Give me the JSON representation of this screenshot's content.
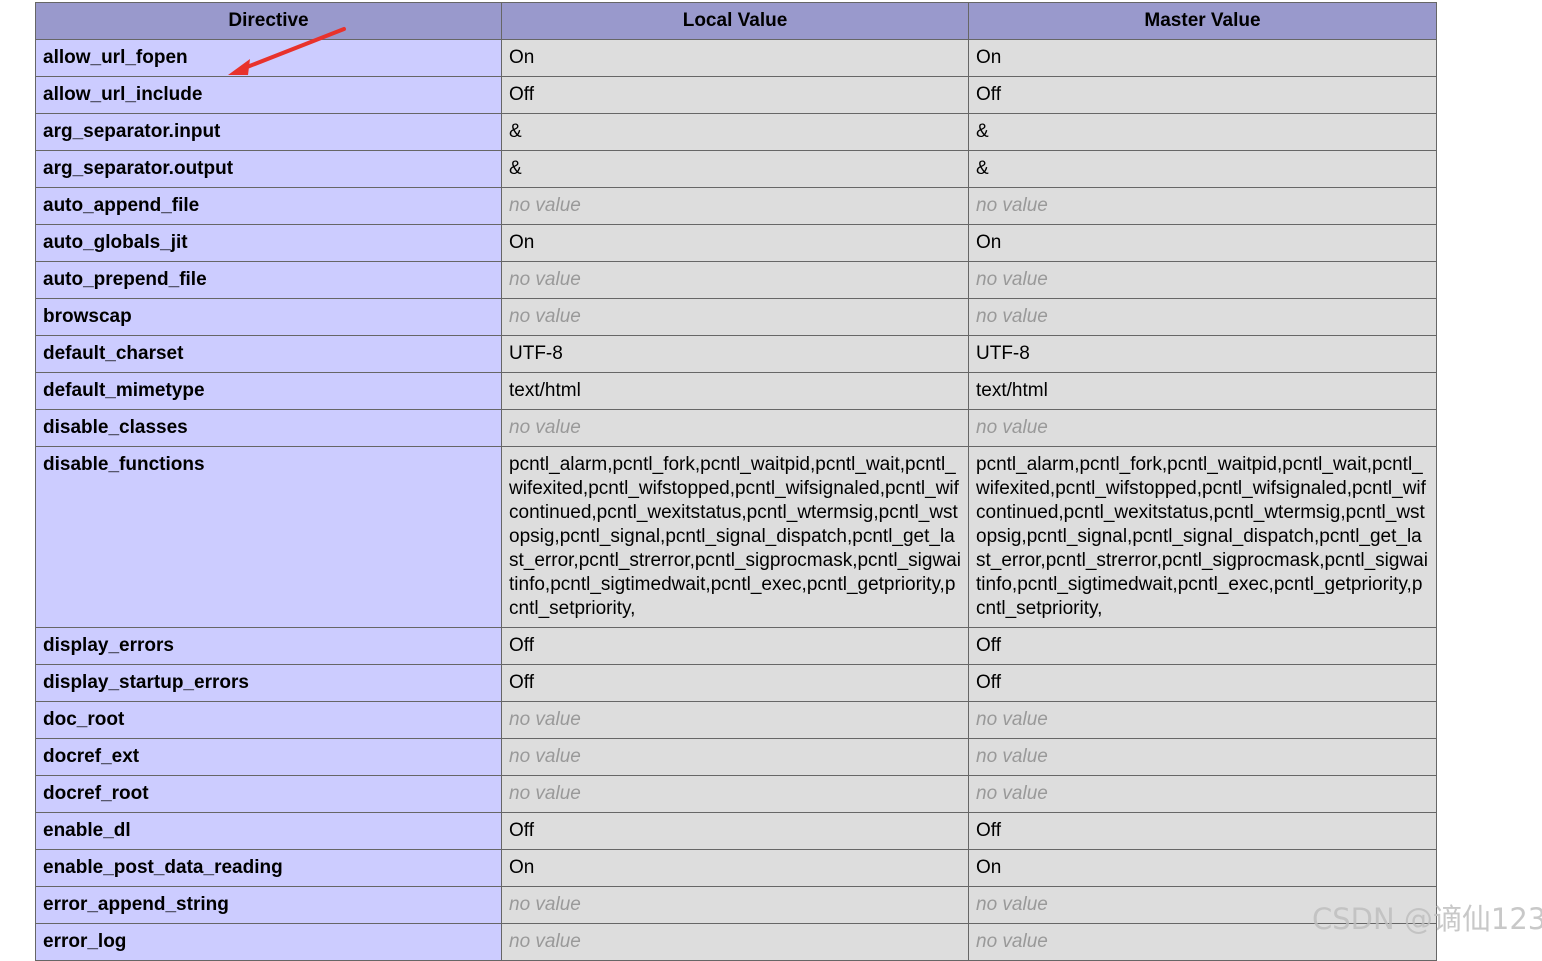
{
  "header": {
    "directive": "Directive",
    "local_value": "Local Value",
    "master_value": "Master Value"
  },
  "rows": [
    {
      "directive": "allow_url_fopen",
      "local": "On",
      "master": "On",
      "no_value": false
    },
    {
      "directive": "allow_url_include",
      "local": "Off",
      "master": "Off",
      "no_value": false
    },
    {
      "directive": "arg_separator.input",
      "local": "&",
      "master": "&",
      "no_value": false
    },
    {
      "directive": "arg_separator.output",
      "local": "&",
      "master": "&",
      "no_value": false
    },
    {
      "directive": "auto_append_file",
      "local": "no value",
      "master": "no value",
      "no_value": true
    },
    {
      "directive": "auto_globals_jit",
      "local": "On",
      "master": "On",
      "no_value": false
    },
    {
      "directive": "auto_prepend_file",
      "local": "no value",
      "master": "no value",
      "no_value": true
    },
    {
      "directive": "browscap",
      "local": "no value",
      "master": "no value",
      "no_value": true
    },
    {
      "directive": "default_charset",
      "local": "UTF-8",
      "master": "UTF-8",
      "no_value": false
    },
    {
      "directive": "default_mimetype",
      "local": "text/html",
      "master": "text/html",
      "no_value": false
    },
    {
      "directive": "disable_classes",
      "local": "no value",
      "master": "no value",
      "no_value": true
    },
    {
      "directive": "disable_functions",
      "local": "pcntl_alarm,pcntl_fork,pcntl_waitpid,pcntl_wait,pcntl_wifexited,pcntl_wifstopped,pcntl_wifsignaled,pcntl_wifcontinued,pcntl_wexitstatus,pcntl_wtermsig,pcntl_wstopsig,pcntl_signal,pcntl_signal_dispatch,pcntl_get_last_error,pcntl_strerror,pcntl_sigprocmask,pcntl_sigwaitinfo,pcntl_sigtimedwait,pcntl_exec,pcntl_getpriority,pcntl_setpriority,",
      "master": "pcntl_alarm,pcntl_fork,pcntl_waitpid,pcntl_wait,pcntl_wifexited,pcntl_wifstopped,pcntl_wifsignaled,pcntl_wifcontinued,pcntl_wexitstatus,pcntl_wtermsig,pcntl_wstopsig,pcntl_signal,pcntl_signal_dispatch,pcntl_get_last_error,pcntl_strerror,pcntl_sigprocmask,pcntl_sigwaitinfo,pcntl_sigtimedwait,pcntl_exec,pcntl_getpriority,pcntl_setpriority,",
      "no_value": false,
      "multiline": true
    },
    {
      "directive": "display_errors",
      "local": "Off",
      "master": "Off",
      "no_value": false
    },
    {
      "directive": "display_startup_errors",
      "local": "Off",
      "master": "Off",
      "no_value": false
    },
    {
      "directive": "doc_root",
      "local": "no value",
      "master": "no value",
      "no_value": true
    },
    {
      "directive": "docref_ext",
      "local": "no value",
      "master": "no value",
      "no_value": true
    },
    {
      "directive": "docref_root",
      "local": "no value",
      "master": "no value",
      "no_value": true
    },
    {
      "directive": "enable_dl",
      "local": "Off",
      "master": "Off",
      "no_value": false
    },
    {
      "directive": "enable_post_data_reading",
      "local": "On",
      "master": "On",
      "no_value": false
    },
    {
      "directive": "error_append_string",
      "local": "no value",
      "master": "no value",
      "no_value": true
    },
    {
      "directive": "error_log",
      "local": "no value",
      "master": "no value",
      "no_value": true
    }
  ],
  "annotation": {
    "arrow_color": "#e8322c",
    "arrow_target": "allow_url_fopen"
  },
  "watermark": {
    "text": "CSDN @谪仙123"
  },
  "colors": {
    "header_bg": "#9999cc",
    "directive_bg": "#ccccff",
    "value_bg": "#dddddd",
    "no_value_text": "#999999",
    "border": "#666666"
  }
}
